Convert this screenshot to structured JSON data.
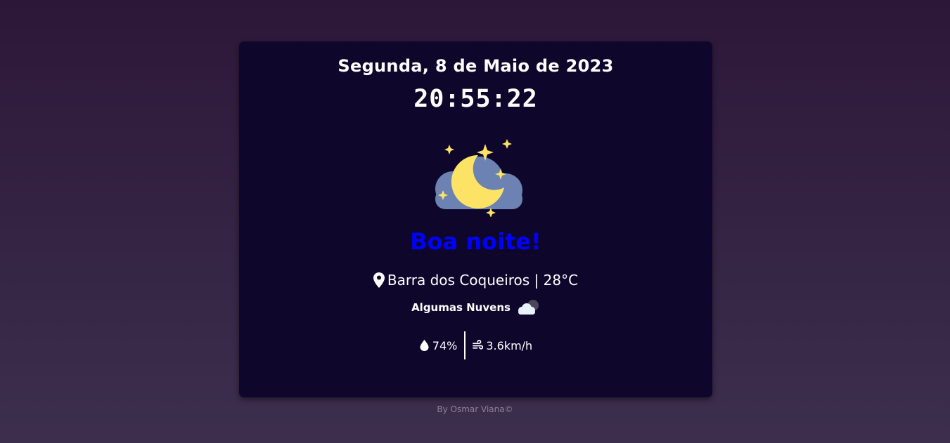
{
  "card": {
    "date": "Segunda, 8 de Maio de 2023",
    "time": "20:55:22",
    "weather_icon": "moon-cloud-stars-icon",
    "greeting": "Boa noite!",
    "location_icon": "map-pin-icon",
    "location": "Barra dos Coqueiros | 28°C",
    "conditions": "Algumas Nuvens",
    "conditions_icon": "cloud-moon-icon",
    "humidity_icon": "water-drop-icon",
    "humidity": "74%",
    "wind_icon": "wind-icon",
    "wind": "3.6km/h"
  },
  "footer": {
    "credit": "By Osmar Viana©"
  },
  "colors": {
    "background_top": "#2d1739",
    "background_bottom": "#3c2f4d",
    "card": "#0f062c",
    "greeting": "#0000ff",
    "moon": "#fde365",
    "cloud": "#6c82b3",
    "credit": "#8e8296"
  }
}
